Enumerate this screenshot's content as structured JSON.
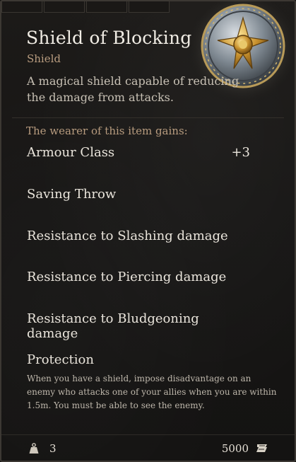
{
  "item": {
    "name": "Shield of Blocking",
    "type": "Shield",
    "description": "A magical shield capable of reducing the damage from attacks.",
    "icon": "round-shield-icon"
  },
  "effects": {
    "header": "The wearer of this item gains:",
    "properties": [
      {
        "label": "Armour Class",
        "value": "+3"
      },
      {
        "label": "Saving Throw",
        "value": ""
      },
      {
        "label": "Resistance to Slashing damage",
        "value": ""
      },
      {
        "label": "Resistance to Piercing damage",
        "value": ""
      },
      {
        "label": "Resistance to Bludgeoning damage",
        "value": ""
      }
    ],
    "passive": {
      "title": "Protection",
      "text": "When you have a shield, impose disadvantage on an enemy who attacks one of your allies when you are within 1.5m. You must be able to see the enemy."
    }
  },
  "footer": {
    "weight": "3",
    "weight_icon": "weight-icon",
    "price": "5000",
    "price_icon": "gold-icon"
  },
  "colors": {
    "background": "#171615",
    "title": "#f0ece4",
    "accent_label": "#b89c7f",
    "body_text": "#c7c0b4"
  }
}
